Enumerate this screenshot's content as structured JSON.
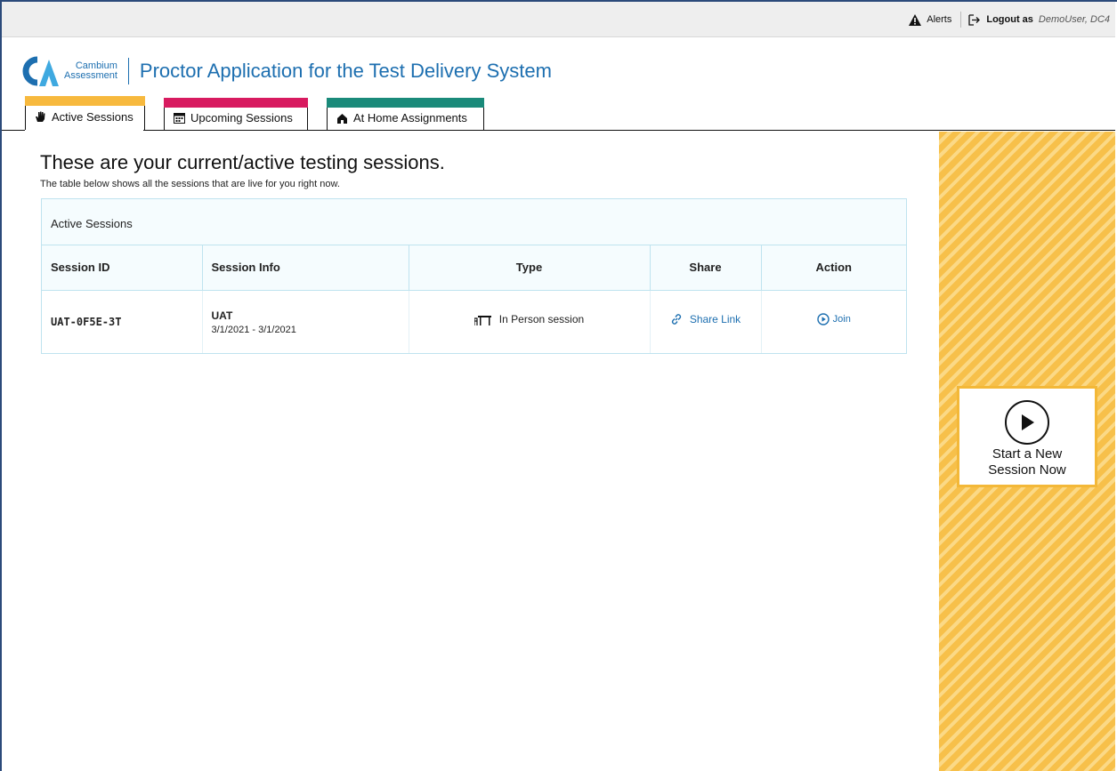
{
  "topbar": {
    "alerts_label": "Alerts",
    "logout_label": "Logout as",
    "user_name": "DemoUser, DC4"
  },
  "header": {
    "logo_line1": "Cambium",
    "logo_line2": "Assessment",
    "app_title": "Proctor Application for the Test Delivery System"
  },
  "tabs": [
    {
      "label": "Active Sessions",
      "icon": "hand-icon",
      "color": "#f7b93e",
      "active": true
    },
    {
      "label": "Upcoming Sessions",
      "icon": "calendar-icon",
      "color": "#d81b60",
      "active": false
    },
    {
      "label": "At Home Assignments",
      "icon": "home-icon",
      "color": "#1a8a7a",
      "active": false
    }
  ],
  "main": {
    "heading": "These are your current/active testing sessions.",
    "subheading": "The table below shows all the sessions that are live for you right now.",
    "table": {
      "caption": "Active Sessions",
      "columns": [
        "Session ID",
        "Session Info",
        "Type",
        "Share",
        "Action"
      ],
      "rows": [
        {
          "session_id": "UAT-0F5E-3T",
          "session_name": "UAT",
          "session_dates": "3/1/2021 - 3/1/2021",
          "type": "In Person session",
          "share": "Share Link",
          "action": "Join"
        }
      ]
    }
  },
  "side": {
    "start_label": "Start a New Session Now"
  },
  "colors": {
    "accent_blue": "#1d6fb0",
    "side_yellow": "#f7c04a",
    "table_border": "#bfe3ef"
  }
}
